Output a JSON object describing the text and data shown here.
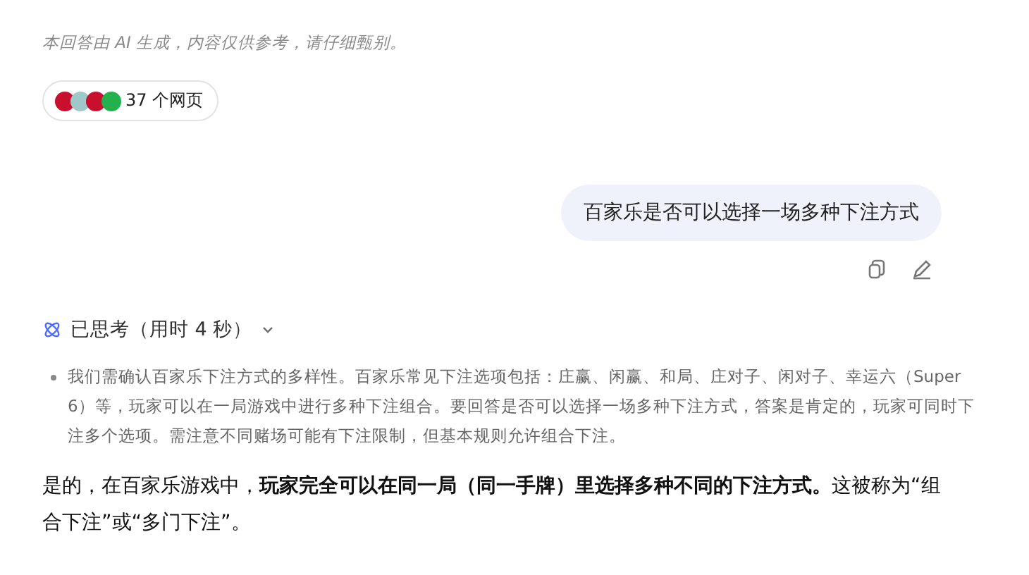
{
  "disclaimer": "本回答由 AI 生成，内容仅供参考，请仔细甄别。",
  "sources": {
    "label": "37 个网页",
    "icons": [
      {
        "color": "#c8102e"
      },
      {
        "color": "#9fc9c9"
      },
      {
        "color": "#c8102e"
      },
      {
        "color": "#22b14c"
      }
    ]
  },
  "user_message": {
    "text": "百家乐是否可以选择一场多种下注方式"
  },
  "thinking": {
    "label": "已思考（用时 4 秒）",
    "expanded": true,
    "steps": [
      "我们需确认百家乐下注方式的多样性。百家乐常见下注选项包括：庄赢、闲赢、和局、庄对子、闲对子、幸运六（Super 6）等，玩家可以在一局游戏中进行多种下注组合。要回答是否可以选择一场多种下注方式，答案是肯定的，玩家可同时下注多个选项。需注意不同赌场可能有下注限制，但基本规则允许组合下注。"
    ]
  },
  "answer": "是的，在百家乐游戏中，**玩家完全可以在同一局（同一手牌）里选择多种不同的下注方式。**这被称为“组合下注”或“多门下注”。"
}
